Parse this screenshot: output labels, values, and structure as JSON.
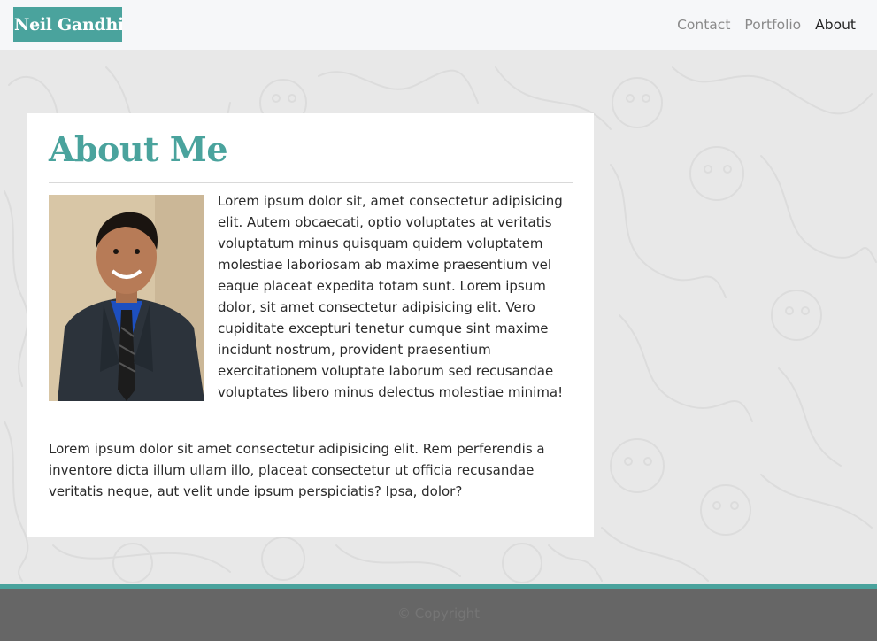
{
  "navbar": {
    "brand": "Neil Gandhi",
    "links": [
      {
        "label": "Contact",
        "active": false
      },
      {
        "label": "Portfolio",
        "active": false
      },
      {
        "label": "About",
        "active": true
      }
    ]
  },
  "about": {
    "title": "About Me",
    "paragraph_1": "Lorem ipsum dolor sit, amet consectetur adipisicing elit. Autem obcaecati, optio voluptates at veritatis voluptatum minus quisquam quidem voluptatem molestiae laboriosam ab maxime praesentium vel eaque placeat expedita totam sunt. Lorem ipsum dolor, sit amet consectetur adipisicing elit. Vero cupiditate excepturi tenetur cumque sint maxime incidunt nostrum, provident praesentium exercitationem voluptate laborum sed recusandae voluptates libero minus delectus molestiae minima!",
    "paragraph_2": "Lorem ipsum dolor sit amet consectetur adipisicing elit. Rem perferendis a inventore dicta illum ullam illo, placeat consectetur ut officia recusandae veritatis neque, aut velit unde ipsum perspiciatis? Ipsa, dolor?"
  },
  "footer": {
    "copyright": "© Copyright"
  },
  "colors": {
    "accent": "#4aa39d",
    "footer_bg": "#666666",
    "navbar_bg": "#f6f7f9"
  }
}
